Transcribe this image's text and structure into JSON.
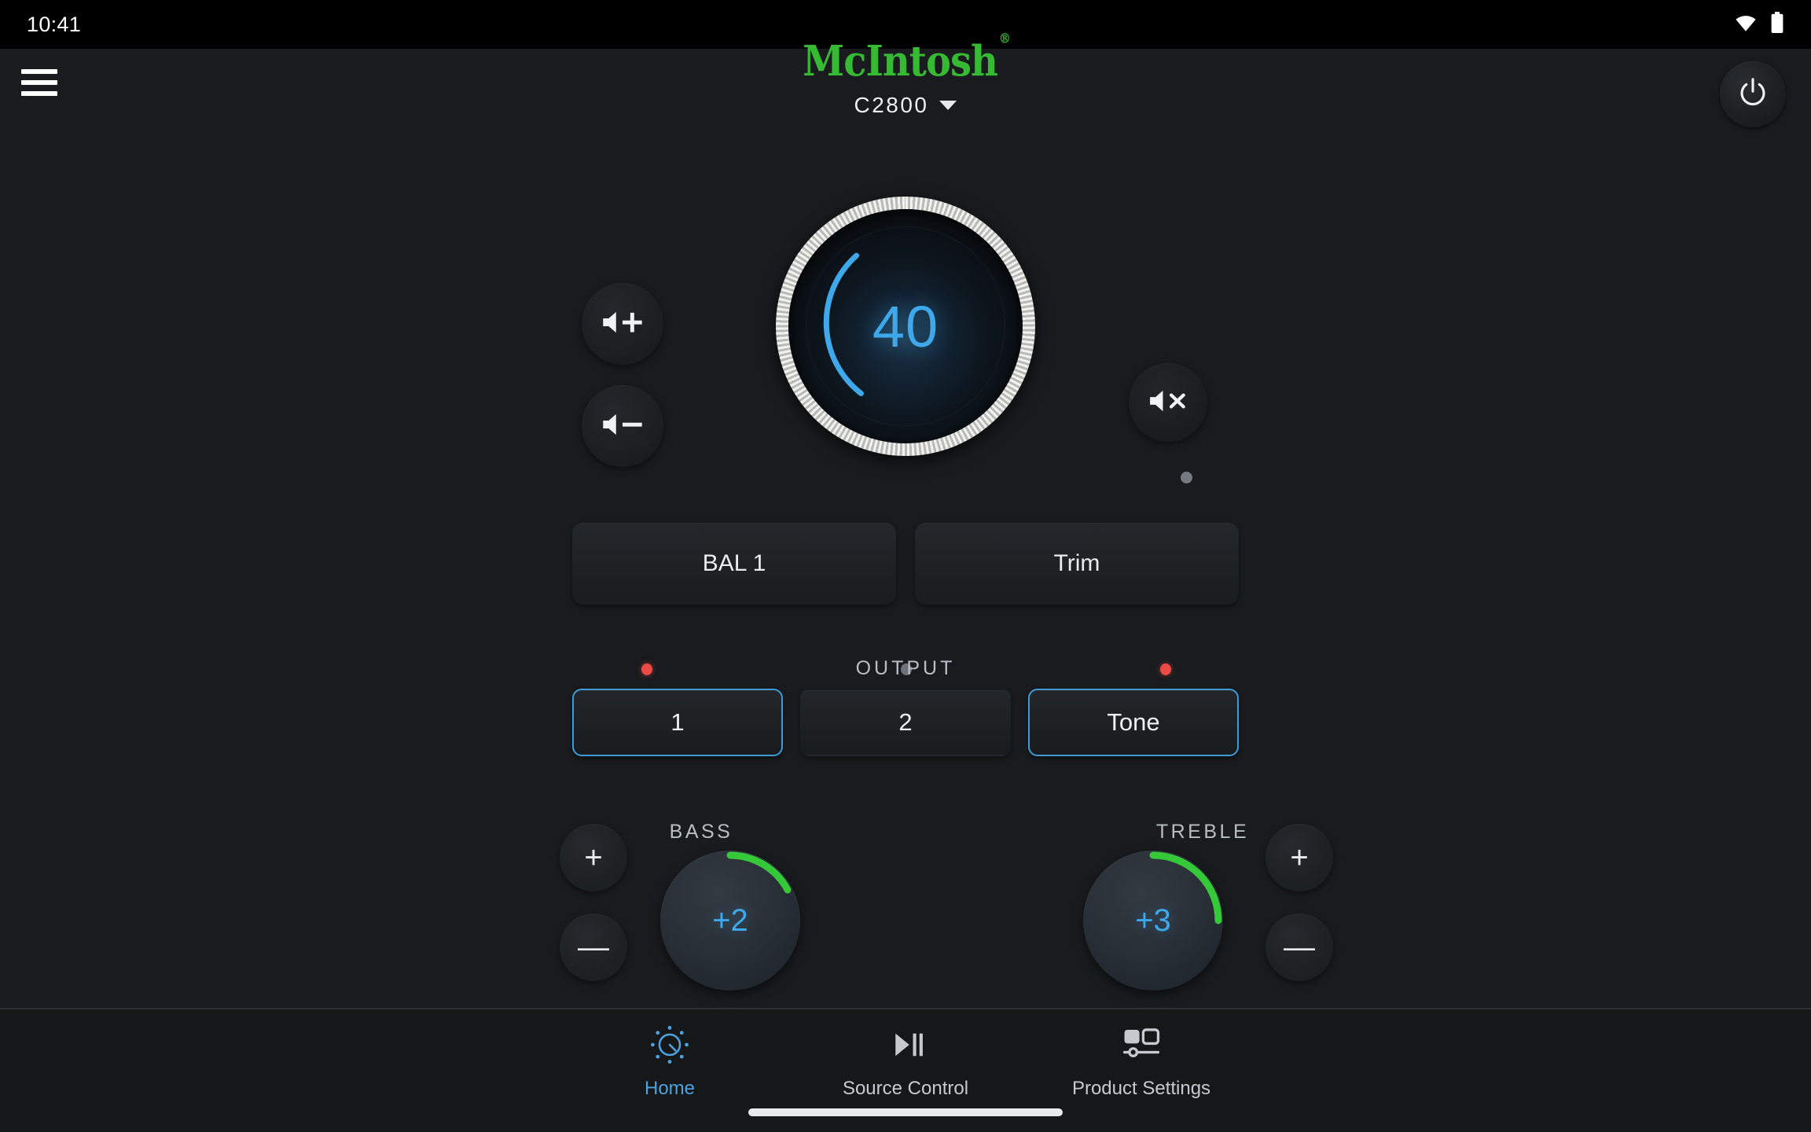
{
  "status_bar": {
    "clock": "10:41",
    "wifi_icon": "wifi-icon",
    "battery_icon": "battery-icon"
  },
  "header": {
    "menu_icon": "hamburger-menu-icon",
    "brand": "McIntosh",
    "brand_trademark": "®",
    "brand_color": "#36b933",
    "model": "C2800",
    "model_dropdown_icon": "chevron-down-icon",
    "power_icon": "power-icon"
  },
  "volume": {
    "value": "40",
    "up_label": "volume-up",
    "down_label": "volume-down",
    "mute_label": "mute",
    "mute_indicator_color": "#767b82",
    "accent_color": "#3ea8ea",
    "arc_start_deg": -150,
    "arc_sweep_deg": 170
  },
  "quick_buttons": [
    {
      "label": "BAL 1",
      "name": "bal-button"
    },
    {
      "label": "Trim",
      "name": "trim-button"
    }
  ],
  "output": {
    "section_label": "OUTPUT",
    "buttons": [
      {
        "label": "1",
        "active": true,
        "led": "red",
        "led_color": "#ec4a44"
      },
      {
        "label": "2",
        "active": false,
        "led": "off",
        "led_color": "#6e737a"
      },
      {
        "label": "Tone",
        "active": true,
        "led": "red",
        "led_color": "#ec4a44"
      }
    ]
  },
  "tone": {
    "bass": {
      "label": "BASS",
      "value": "+2",
      "arc_color": "#35c93a",
      "arc_sweep_deg": 62,
      "plus_label": "+",
      "minus_label": "—"
    },
    "treble": {
      "label": "TREBLE",
      "value": "+3",
      "arc_color": "#35c93a",
      "arc_sweep_deg": 90,
      "plus_label": "+",
      "minus_label": "—"
    }
  },
  "bottom_nav": {
    "active_color": "#4aa3e0",
    "items": [
      {
        "label": "Home",
        "icon": "dial-knob-icon",
        "active": true
      },
      {
        "label": "Source Control",
        "icon": "play-pause-icon",
        "active": false
      },
      {
        "label": "Product Settings",
        "icon": "panels-slider-icon",
        "active": false
      }
    ]
  }
}
